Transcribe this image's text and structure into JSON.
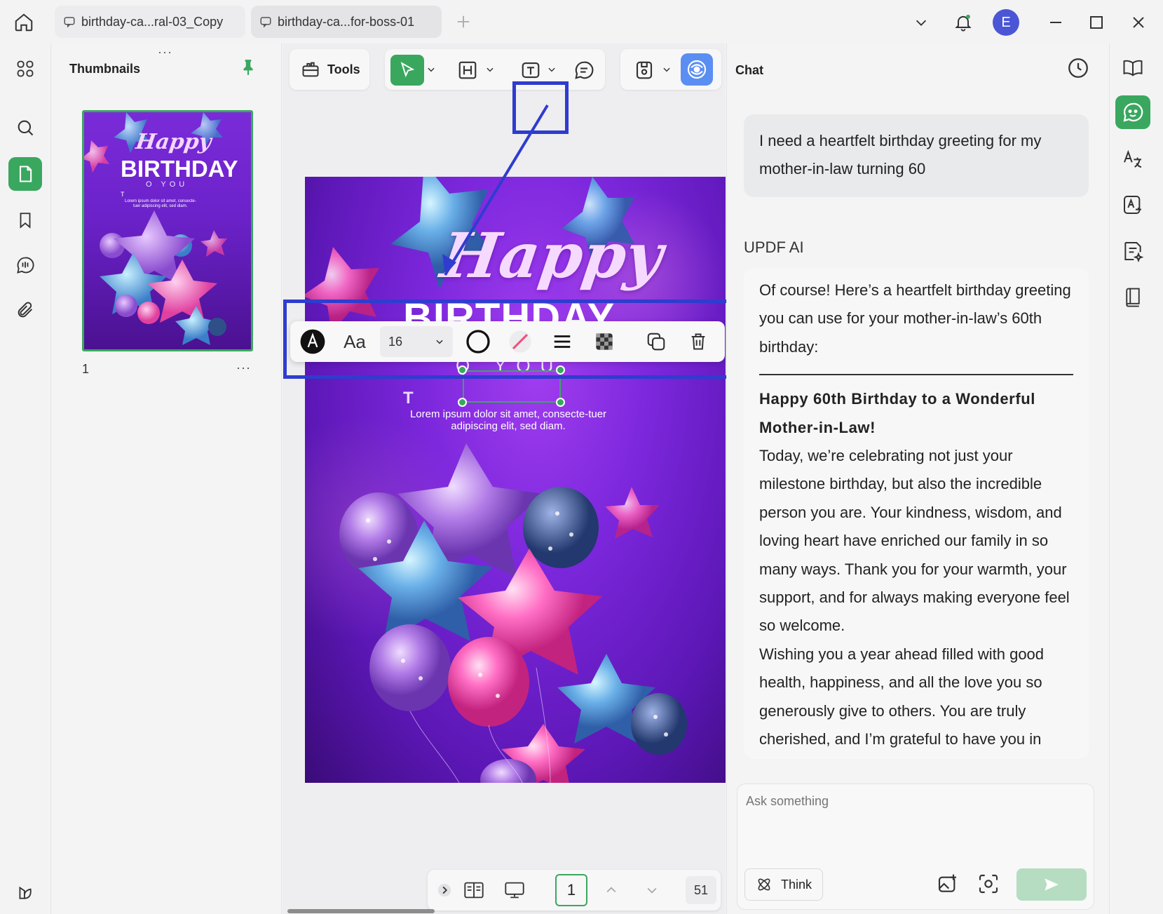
{
  "tabs": [
    {
      "label": "birthday-ca...ral-03_Copy"
    },
    {
      "label": "birthday-ca...for-boss-01"
    }
  ],
  "user": {
    "avatar_letter": "E"
  },
  "thumbnails": {
    "title": "Thumbnails",
    "page_number": "1",
    "more": "···"
  },
  "toolbar": {
    "tools_label": "Tools"
  },
  "document": {
    "happy": "Happy",
    "birthday": "BIRTHDAY",
    "to_you": "O YOU",
    "text_marker": "T",
    "lorem": "Lorem ipsum dolor sit amet, consecte-tuer adipiscing elit, sed diam."
  },
  "format_bar": {
    "font_label": "Aa",
    "font_size": "16"
  },
  "bottom_nav": {
    "current_page": "1",
    "total_pages": "51"
  },
  "chat": {
    "title": "Chat",
    "user_message": "I need a heartfelt birthday greeting for my mother-in-law turning 60",
    "ai_label": "UPDF AI",
    "ai_intro": "Of course! Here’s a heartfelt birthday greeting you can use for your mother-in-law’s 60th birthday:",
    "ai_heading": "Happy 60th Birthday to a Wonderful Mother-in-Law!",
    "ai_body_1": "Today, we’re celebrating not just your milestone birthday, but also the incredible person you are. Your kindness, wisdom, and loving heart have enriched our family in so many ways. Thank you for your warmth, your support, and for always making everyone feel so welcome.",
    "ai_body_2": "Wishing you a year ahead filled with good health, happiness, and all the love you so generously give to others. You are truly cherished, and I’m grateful to have you in",
    "ask_placeholder": "Ask something",
    "think_label": "Think"
  },
  "colors": {
    "accent": "#3aa75f",
    "highlight": "#2f3ccf",
    "avatar": "#4b56d6"
  }
}
